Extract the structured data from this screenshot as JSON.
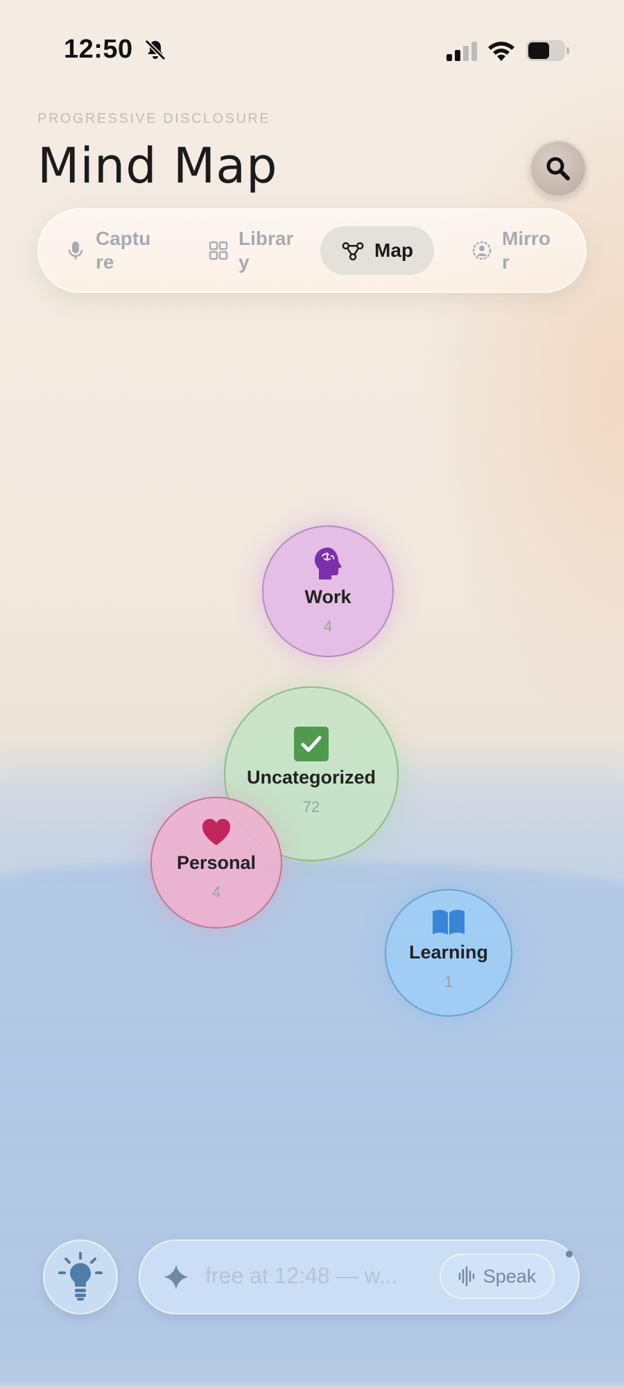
{
  "status_bar": {
    "time": "12:50"
  },
  "header": {
    "eyebrow": "PROGRESSIVE DISCLOSURE",
    "title": "Mind Map"
  },
  "tabs": [
    {
      "label": "Capture",
      "icon": "microphone-icon",
      "active": false
    },
    {
      "label": "Library",
      "icon": "grid-icon",
      "active": false
    },
    {
      "label": "Map",
      "icon": "nodes-icon",
      "active": true
    },
    {
      "label": "Mirror",
      "icon": "person-circle-icon",
      "active": false
    }
  ],
  "categories": [
    {
      "name": "Work",
      "count": "4",
      "icon": "brain-head-icon",
      "color": "#7b2fa8"
    },
    {
      "name": "Uncategorized",
      "count": "72",
      "icon": "checkbox-icon",
      "color": "#4f9a4f"
    },
    {
      "name": "Personal",
      "count": "4",
      "icon": "heart-icon",
      "color": "#c2255c"
    },
    {
      "name": "Learning",
      "count": "1",
      "icon": "book-icon",
      "color": "#3a86d6"
    }
  ],
  "composer": {
    "placeholder": "free at 12:48 — w...",
    "speak_label": "Speak"
  }
}
